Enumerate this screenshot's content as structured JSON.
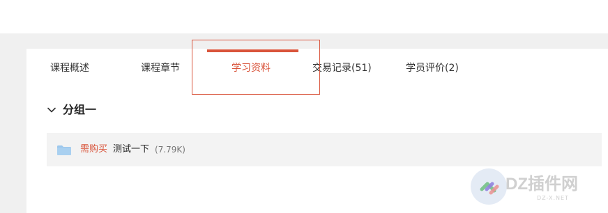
{
  "tabs": [
    {
      "label": "课程概述"
    },
    {
      "label": "课程章节"
    },
    {
      "label": "学习资料"
    },
    {
      "label": "交易记录(51)"
    },
    {
      "label": "学员评价(2)"
    }
  ],
  "active_tab": "学习资料",
  "group": {
    "title": "分组一"
  },
  "resources": [
    {
      "badge": "需购买",
      "name": "测试一下",
      "size": "(7.79K)"
    }
  ],
  "watermark": {
    "main": "DZ插件网",
    "sub": "DZ-X.NET"
  },
  "colors": {
    "accent": "#d9543b",
    "folder": "#9cc7ec",
    "row_bg": "#f3f3f3",
    "page_bg": "#f0f0f0"
  },
  "icons": {
    "group_toggle": "chevron-down-icon",
    "resource": "folder-icon",
    "watermark": "dz-logo-icon"
  }
}
